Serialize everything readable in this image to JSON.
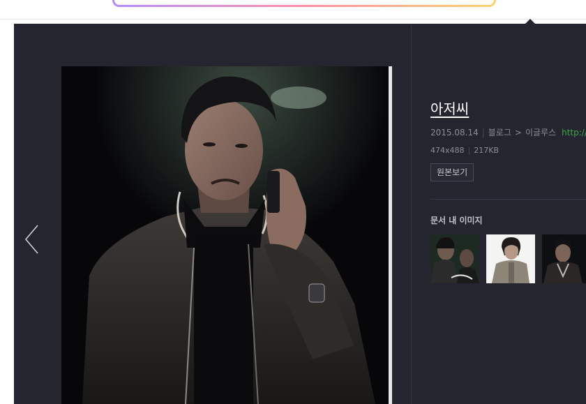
{
  "image": {
    "title": "아저씨",
    "date": "2015.08.14",
    "source_type": "블로그",
    "source_name": "이글루스",
    "source_url": "http://nj",
    "dimensions": "474x488",
    "file_size": "217KB",
    "original_button_label": "원본보기"
  },
  "related": {
    "heading": "문서 내 이미지"
  },
  "theme": {
    "viewer_bg": "#25252f",
    "link_color": "#3da54d",
    "meta_text": "#8d8d99"
  },
  "icons": {
    "prev": "chevron-left-icon"
  }
}
